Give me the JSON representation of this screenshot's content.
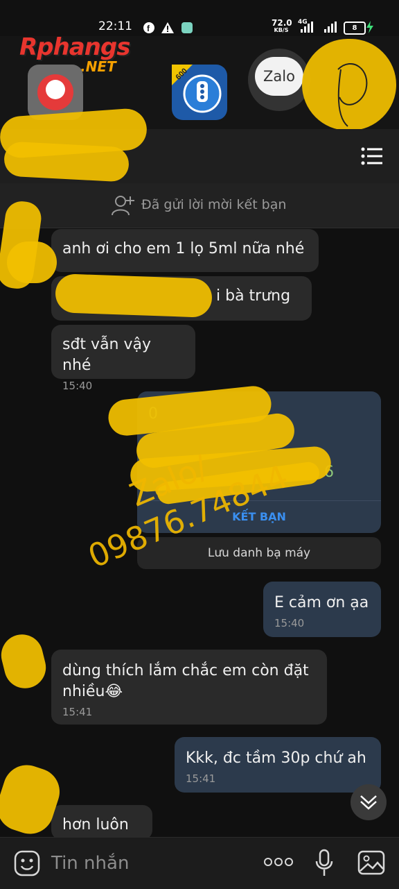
{
  "status": {
    "time": "22:11",
    "net_speed": "72.0",
    "net_unit": "KB/S",
    "network": "4G",
    "battery": "8"
  },
  "logo": {
    "brand": "Rphangs",
    "suffix": ".NET"
  },
  "apps": {
    "zalo_label": "Zalo",
    "badge": "600"
  },
  "friend_bar": {
    "text": "Đã gửi lời mời kết bạn"
  },
  "messages": [
    {
      "text": "anh ơi cho em 1 lọ 5ml nữa nhé",
      "time": ""
    },
    {
      "text": "i bà trưng",
      "time": ""
    },
    {
      "text": "sđt vẫn vậy nhé",
      "time": "15:40"
    },
    {
      "text": "E cảm ơn ạa",
      "time": "15:40"
    },
    {
      "text": "dùng thích lắm chắc em còn đặt nhiều😂",
      "time": "15:41"
    },
    {
      "text": "Kkk, đc tầm 30p chứ ah",
      "time": "15:41"
    },
    {
      "text": "hơn luôn ý",
      "time": ""
    }
  ],
  "contact_card": {
    "button": "KẾT BẠN",
    "save_label": "Lưu danh bạ máy",
    "partial_first": "0",
    "partial_last": "6"
  },
  "watermark": {
    "line1": "Zalo/",
    "line2": "09876.74844"
  },
  "input": {
    "placeholder": "Tin nhắn"
  },
  "colors": {
    "accent": "#3a8ff0",
    "highlight": "#f2c000",
    "bubble_me": "#2c3a4c",
    "bubble_other": "#2a2a2a"
  }
}
